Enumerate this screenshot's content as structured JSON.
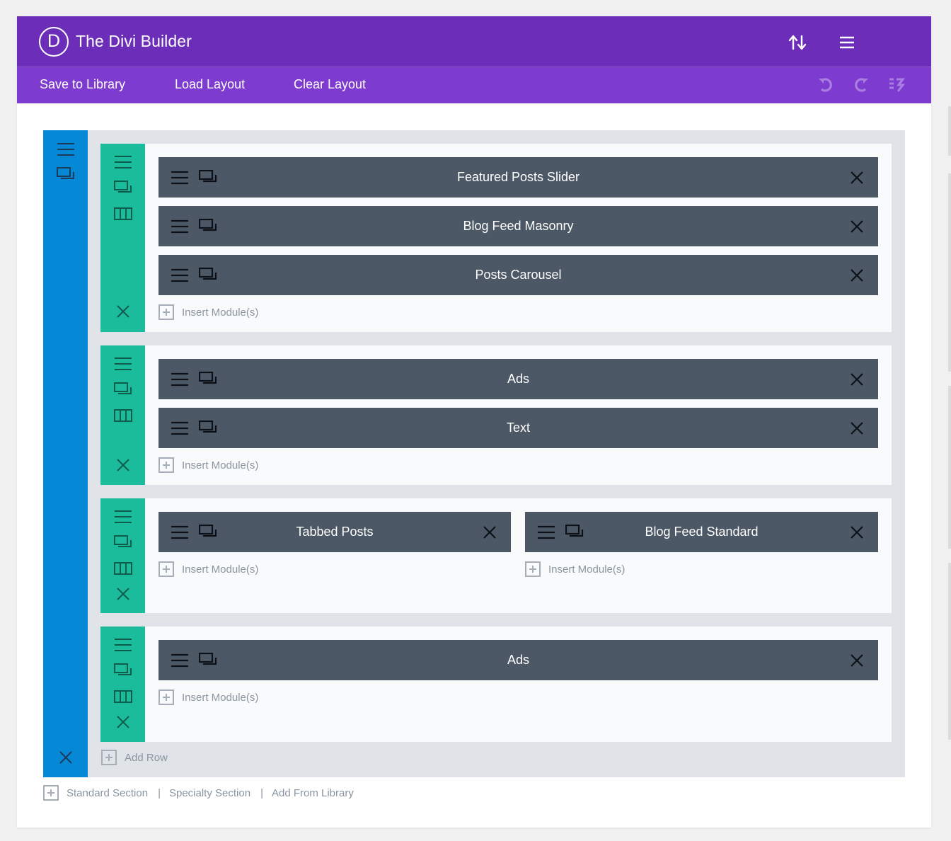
{
  "app": {
    "title": "The Divi Builder",
    "logo_letter": "D"
  },
  "toolbar": {
    "save_label": "Save to Library",
    "load_label": "Load Layout",
    "clear_label": "Clear Layout"
  },
  "rows": [
    {
      "modules": [
        "Featured Posts Slider",
        "Blog Feed Masonry",
        "Posts Carousel"
      ],
      "insert_label": "Insert Module(s)"
    },
    {
      "modules": [
        "Ads",
        "Text"
      ],
      "insert_label": "Insert Module(s)"
    },
    {
      "columns": [
        {
          "module": "Tabbed Posts",
          "insert_label": "Insert Module(s)"
        },
        {
          "module": "Blog Feed Standard",
          "insert_label": "Insert Module(s)"
        }
      ]
    },
    {
      "modules": [
        "Ads"
      ],
      "insert_label": "Insert Module(s)"
    }
  ],
  "section": {
    "add_row_label": "Add Row"
  },
  "footer": {
    "standard_section": "Standard Section",
    "specialty_section": "Specialty Section",
    "add_from_library": "Add From Library",
    "separator": "|"
  },
  "colors": {
    "header": "#6c2eb9",
    "toolbar": "#7e3bd0",
    "section": "#0588d6",
    "row": "#1bbc9c",
    "module": "#4c5866",
    "disabled_icon": "#a87ee0"
  },
  "icons": {
    "sort": "sort-arrows-icon",
    "menu": "hamburger-menu-icon",
    "undo": "undo-icon",
    "redo": "redo-icon",
    "history": "history-icon",
    "settings": "hamburger-icon",
    "duplicate": "duplicate-icon",
    "columns": "columns-icon",
    "delete": "close-icon",
    "add": "plus-box-icon"
  }
}
